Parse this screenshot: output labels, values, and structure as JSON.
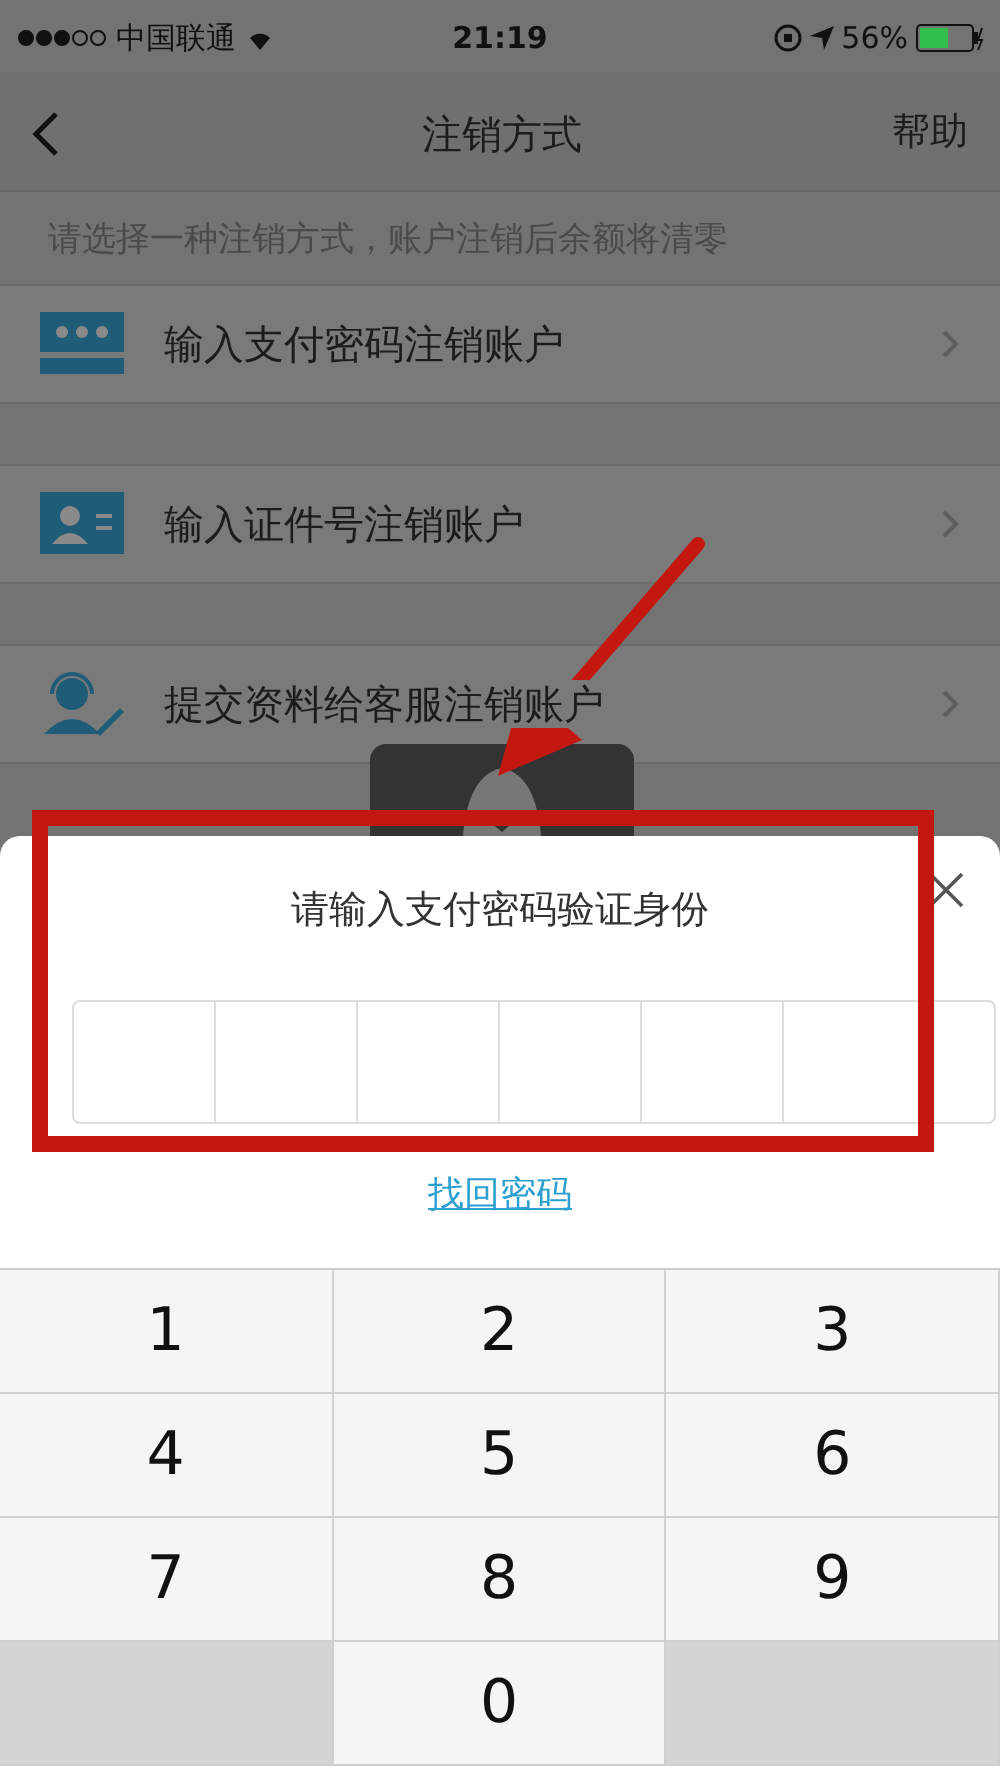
{
  "status_bar": {
    "carrier": "中国联通",
    "time": "21:19",
    "battery": "56%"
  },
  "nav": {
    "title": "注销方式",
    "action": "帮助"
  },
  "hint": "请选择一种注销方式，账户注销后余额将清零",
  "options": [
    {
      "kind": "password",
      "label": "输入支付密码注销账户"
    },
    {
      "kind": "id-card",
      "label": "输入证件号注销账户"
    },
    {
      "kind": "service",
      "label": "提交资料给客服注销账户"
    }
  ],
  "sheet": {
    "title": "请输入支付密码验证身份",
    "link": "找回密码"
  },
  "keypad": [
    {
      "kind": "digit",
      "label": "1"
    },
    {
      "kind": "digit",
      "label": "2"
    },
    {
      "kind": "digit",
      "label": "3"
    },
    {
      "kind": "digit",
      "label": "4"
    },
    {
      "kind": "digit",
      "label": "5"
    },
    {
      "kind": "digit",
      "label": "6"
    },
    {
      "kind": "digit",
      "label": "7"
    },
    {
      "kind": "digit",
      "label": "8"
    },
    {
      "kind": "digit",
      "label": "9"
    },
    {
      "kind": "blank"
    },
    {
      "kind": "digit",
      "label": "0"
    },
    {
      "kind": "blank"
    }
  ]
}
